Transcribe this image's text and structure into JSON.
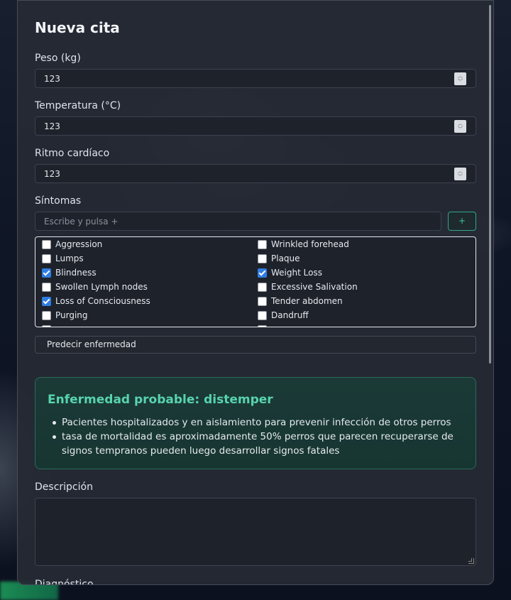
{
  "form": {
    "title": "Nueva cita",
    "weight": {
      "label": "Peso (kg)",
      "value": "123"
    },
    "temperature": {
      "label": "Temperatura (°C)",
      "value": "123"
    },
    "heart_rate": {
      "label": "Ritmo cardíaco",
      "value": "123"
    },
    "symptoms": {
      "label": "Síntomas",
      "placeholder": "Escribe y pulsa +",
      "add_label": "+",
      "items": [
        {
          "label": "Aggression",
          "checked": false
        },
        {
          "label": "Wrinkled forehead",
          "checked": false
        },
        {
          "label": "Lumps",
          "checked": false
        },
        {
          "label": "Plaque",
          "checked": false
        },
        {
          "label": "Blindness",
          "checked": true
        },
        {
          "label": "Weight Loss",
          "checked": true
        },
        {
          "label": "Swollen Lymph nodes",
          "checked": false
        },
        {
          "label": "Excessive Salivation",
          "checked": false
        },
        {
          "label": "Loss of Consciousness",
          "checked": false
        },
        {
          "label": "Tender abdomen",
          "checked": false
        },
        {
          "label": "Purging",
          "checked": false
        },
        {
          "label": "Dandruff",
          "checked": false
        }
      ]
    },
    "predict_label": "Predecir enfermedad",
    "result": {
      "title": "Enfermedad probable: distemper",
      "points": [
        "Pacientes hospitalizados y en aislamiento para prevenir infección de otros perros",
        "tasa de mortalidad es aproximadamente 50% perros que parecen recuperarse de signos tempranos pueden luego desarrollar signos fatales"
      ]
    },
    "description_label": "Descripción",
    "diagnosis_label": "Diagnóstico"
  },
  "icons": {
    "spinner": "number-spinner-icon",
    "checkbox_checked": "checkmark-icon",
    "resize": "resize-grip-icon"
  },
  "colors": {
    "accent_green": "#58d3ae",
    "checkbox_blue": "#2f7de1",
    "result_bg": "#1b3a37"
  }
}
